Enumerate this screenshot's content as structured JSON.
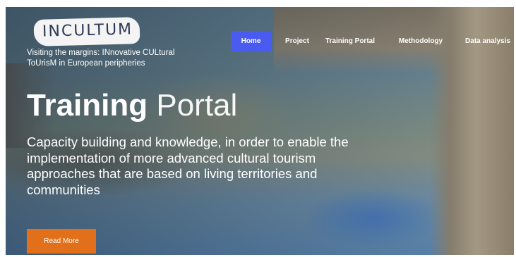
{
  "logo": {
    "text": "INCULTUM"
  },
  "tagline": "Visiting the margins: INnovative CULtural ToUrisM in European peripheries",
  "nav": [
    {
      "label": "Home",
      "active": true
    },
    {
      "label": "Project",
      "active": false
    },
    {
      "label": "Training Portal",
      "active": false
    },
    {
      "label": "Methodology",
      "active": false
    },
    {
      "label": "Data analysis",
      "active": false
    }
  ],
  "hero": {
    "title_bold": "Training",
    "title_light": "Portal",
    "subtitle": "Capacity building and knowledge, in order to enable the implementation of more advanced cultural tourism approaches that are based on living territories and communities",
    "cta_label": "Read More"
  },
  "colors": {
    "nav_active": "#4a5cf0",
    "cta": "#e2701a"
  }
}
